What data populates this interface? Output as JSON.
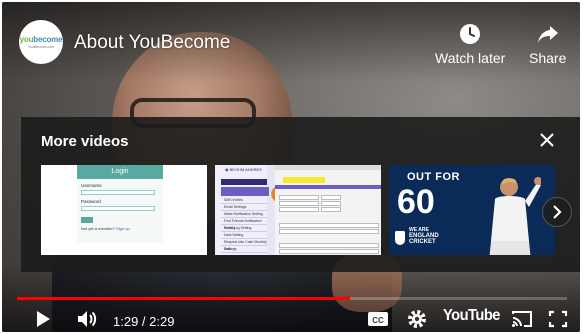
{
  "channel": {
    "logo_word_a": "you",
    "logo_word_b": "become",
    "logo_sub": "YouBecome.com"
  },
  "video": {
    "title": "About YouBecome"
  },
  "top_actions": {
    "watch_later": "Watch later",
    "share": "Share"
  },
  "more_videos": {
    "title": "More videos",
    "thumb1": {
      "heading": "Login",
      "field1": "Username",
      "field2": "Password",
      "button": "Log in",
      "footer_prefix": "Not yet a member? ",
      "footer_link": "Sign up"
    },
    "thumb2": {
      "menu": [
        "SMS Invites",
        "Email Settings",
        "Make Notification Setting",
        "Find Friends Notification Setting",
        "Email Log Setting",
        "Data Setting",
        "Request Use Cash Monthly Settings",
        "Data"
      ]
    },
    "thumb3": {
      "line1": "OUT FOR",
      "number": "60",
      "tag_line1": "WE ARE",
      "tag_line2": "ENGLAND",
      "tag_line3": "CRICKET"
    }
  },
  "player": {
    "time": "1:29 / 2:29",
    "progress_fraction": 0.605,
    "brand": "YouTube",
    "accent": "#ff0000"
  }
}
